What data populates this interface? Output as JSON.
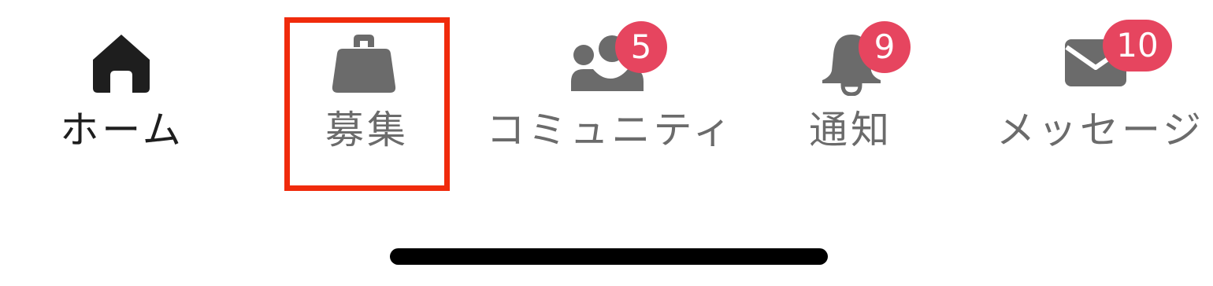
{
  "tabbar": {
    "tabs": [
      {
        "id": "home",
        "label": "ホーム",
        "icon": "home-icon",
        "active": true
      },
      {
        "id": "recruit",
        "label": "募集",
        "icon": "bag-icon",
        "active": false
      },
      {
        "id": "community",
        "label": "コミュニティ",
        "icon": "people-icon",
        "active": false,
        "badge": "5"
      },
      {
        "id": "notifications",
        "label": "通知",
        "icon": "bell-icon",
        "active": false,
        "badge": "9"
      },
      {
        "id": "messages",
        "label": "メッセージ",
        "icon": "envelope-icon",
        "active": false,
        "badge": "10"
      }
    ]
  },
  "colors": {
    "active": "#1e1e1e",
    "inactive": "#6b6b6b",
    "badge": "#e6455f",
    "highlight": "#f02b0c"
  }
}
